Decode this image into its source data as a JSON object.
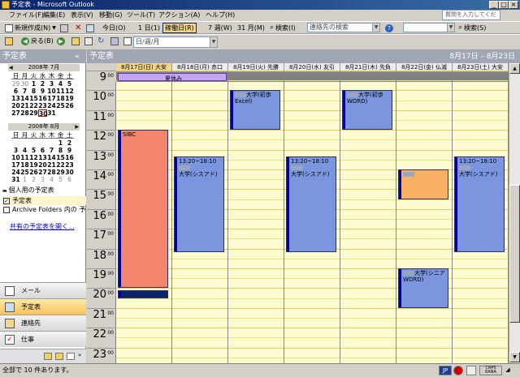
{
  "window": {
    "title": "予定表 - Microsoft Outlook"
  },
  "menu": {
    "items": [
      "ファイル(F)",
      "編集(E)",
      "表示(V)",
      "移動(G)",
      "ツール(T)",
      "アクション(A)",
      "ヘルプ(H)"
    ],
    "help_placeholder": "質問を入力してください"
  },
  "toolbar1": {
    "new_label": "新規作成(N)",
    "today_label": "今日(O)",
    "day_label": "1 日(1)",
    "workweek_label": "稼働日(R)",
    "week_label": "7 週(W)",
    "month_label": "31 月(M)",
    "search_label": "検索(I)",
    "contact_search_placeholder": "連絡先の検索",
    "search2_label": "検索(S)"
  },
  "toolbar2": {
    "back_label": "戻る(B)",
    "view_select": "日/週/月"
  },
  "left": {
    "header": "予定表",
    "cal_july": {
      "title": "2008年 7月",
      "weekdays": [
        "日",
        "月",
        "火",
        "水",
        "木",
        "金",
        "土"
      ],
      "weeks": [
        [
          "29",
          "30",
          "1",
          "2",
          "3",
          "4",
          "5"
        ],
        [
          "6",
          "7",
          "8",
          "9",
          "10",
          "11",
          "12"
        ],
        [
          "13",
          "14",
          "15",
          "16",
          "17",
          "18",
          "19"
        ],
        [
          "20",
          "21",
          "22",
          "23",
          "24",
          "25",
          "26"
        ],
        [
          "27",
          "28",
          "29",
          "30",
          "31",
          "",
          ""
        ]
      ]
    },
    "cal_aug": {
      "title": "2008年 8月",
      "weekdays": [
        "日",
        "月",
        "火",
        "水",
        "木",
        "金",
        "土"
      ],
      "weeks": [
        [
          "",
          "",
          "",
          "",
          "",
          "1",
          "2"
        ],
        [
          "3",
          "4",
          "5",
          "6",
          "7",
          "8",
          "9"
        ],
        [
          "10",
          "11",
          "12",
          "13",
          "14",
          "15",
          "16"
        ],
        [
          "17",
          "18",
          "19",
          "20",
          "21",
          "22",
          "23"
        ],
        [
          "24",
          "25",
          "26",
          "27",
          "28",
          "29",
          "30"
        ],
        [
          "31",
          "1",
          "2",
          "3",
          "4",
          "5",
          "6"
        ]
      ]
    },
    "my_calendars_label": "個人用の予定表",
    "calendar_items": [
      "予定表",
      "Archive Folders 内の 予定表"
    ],
    "share_link": "共有の予定表を開く...",
    "nav": [
      "メール",
      "予定表",
      "連絡先",
      "仕事"
    ]
  },
  "calendar": {
    "header_title": "予定表",
    "date_range": "8月17日 – 8月23日",
    "days": [
      "8月17日(日) 大安",
      "8月18日(月) 赤口",
      "8月19日(火) 先勝",
      "8月20日(水) 友引",
      "8月21日(木) 先負",
      "8月22日(金) 仏滅",
      "8月23日(土) 大安"
    ],
    "hours": [
      "9",
      "10",
      "11",
      "12",
      "13",
      "14",
      "15",
      "16",
      "17",
      "18",
      "19",
      "20",
      "21",
      "22",
      "23"
    ],
    "hour_suffix": "00",
    "allday_event": "夏休み",
    "events": {
      "sun_red": "SIBC",
      "mon_time": "13:20~18:10",
      "mon_text": "大学(シスアド)",
      "tue_text": "大学(初歩Excel)",
      "wed_time": "13:20~18:10",
      "wed_text": "大学(シスアド)",
      "thu_text": "大学(初歩WORD)",
      "fri_text": "大学(シニアWORD)",
      "sat_time": "13:20~18:10",
      "sat_text": "大学(シスアド)"
    }
  },
  "status": {
    "text": "全部で 10 件あります。",
    "ime": "JP",
    "caps": "CAPS KANA"
  }
}
